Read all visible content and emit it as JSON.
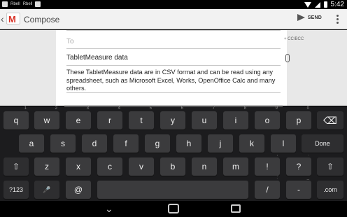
{
  "status_bar": {
    "notifications": [
      "Rbell",
      "Rbell"
    ],
    "time": "5:42"
  },
  "action_bar": {
    "back_glyph": "‹",
    "app_icon": "gmail-icon",
    "title": "Compose",
    "send_label": "SEND"
  },
  "compose": {
    "to_placeholder": "To",
    "cc_bcc_label": "+ CC/BCC",
    "subject": "TabletMeasure data",
    "body": "These TabletMeasure data are in CSV format and can be read using any spreadsheet, such as Microsoft Excel, Works, OpenOffice Calc and many others."
  },
  "keyboard": {
    "row1": [
      {
        "label": "q",
        "sub": "1"
      },
      {
        "label": "w",
        "sub": "2"
      },
      {
        "label": "e",
        "sub": "3"
      },
      {
        "label": "r",
        "sub": "4"
      },
      {
        "label": "t",
        "sub": "5"
      },
      {
        "label": "y",
        "sub": "6"
      },
      {
        "label": "u",
        "sub": "7"
      },
      {
        "label": "i",
        "sub": "8"
      },
      {
        "label": "o",
        "sub": "9"
      },
      {
        "label": "p",
        "sub": "0"
      }
    ],
    "row2": [
      "a",
      "s",
      "d",
      "f",
      "g",
      "h",
      "j",
      "k",
      "l"
    ],
    "row3": [
      "z",
      "x",
      "c",
      "v",
      "b",
      "n",
      "m",
      "!",
      "?"
    ],
    "row1_subs": [
      "1",
      "2",
      "3",
      "4",
      "5",
      "6",
      "7",
      "8",
      "9",
      "0"
    ],
    "row3_subs": [
      "",
      "",
      "",
      "",
      "",
      "",
      "",
      ",",
      "."
    ],
    "backspace": "⌫",
    "done": "Done",
    "shift": "⇧",
    "symbols": "?123",
    "mic": "🎤",
    "at": "@",
    "slash": "/",
    "dash": "-",
    "dotcom": ".com",
    "colon_sub": ":",
    "underscore_sub": "_"
  },
  "nav_bar": {
    "back": "back-icon",
    "home": "home-icon",
    "recents": "recents-icon"
  }
}
